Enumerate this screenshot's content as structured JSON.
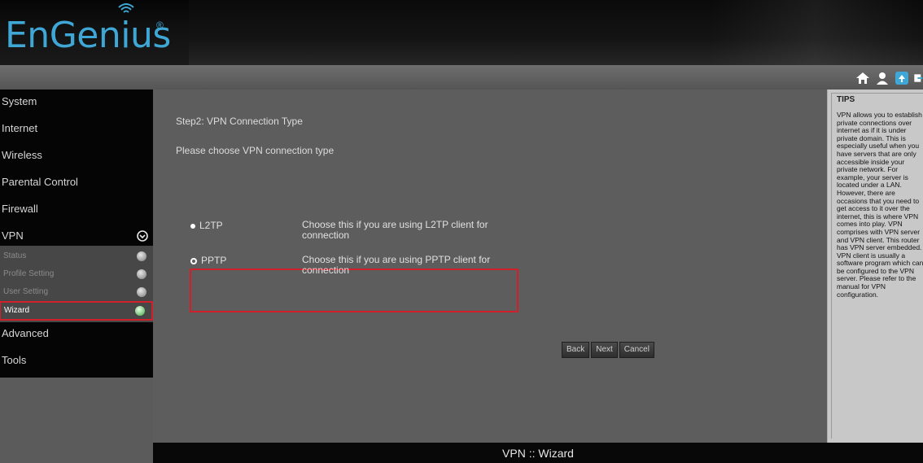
{
  "brand": {
    "logo_text": "EnGenius",
    "registered": "®"
  },
  "top_icons": [
    "home-icon",
    "user-icon",
    "refresh-icon",
    "exit-icon"
  ],
  "sidebar": {
    "items": [
      "System",
      "Internet",
      "Wireless",
      "Parental Control",
      "Firewall",
      "VPN",
      "Advanced",
      "Tools"
    ],
    "vpn_submenu": [
      "Status",
      "Profile Setting",
      "User Setting",
      "Wizard"
    ],
    "active_sub": "Wizard"
  },
  "main": {
    "step_title": "Step2: VPN Connection Type",
    "step_desc": "Please choose VPN connection type",
    "options": [
      {
        "label": "L2TP",
        "desc": "Choose this if you are using L2TP client for connection",
        "selected": false
      },
      {
        "label": "PPTP",
        "desc": "Choose this if you are using PPTP client for connection",
        "selected": true
      }
    ],
    "buttons": {
      "back": "Back",
      "next": "Next",
      "cancel": "Cancel"
    }
  },
  "tips": {
    "title": "TIPS",
    "text": "VPN allows you to establish private connections over internet as if it is under private domain. This is especially useful when you have servers that are only accessible inside your private network. For example, your server is located under a LAN. However, there are occasions that you need to get access to it over the internet, this is where VPN comes into play. VPN comprises with VPN server and VPN client. This router has VPN server embedded. VPN client is usually a software program which can be configured to the VPN server. Please refer to the manual for VPN configuration."
  },
  "footer": {
    "title": "VPN :: Wizard"
  },
  "colors": {
    "accent": "#3fa7d6",
    "highlight_border": "#d1202a"
  }
}
